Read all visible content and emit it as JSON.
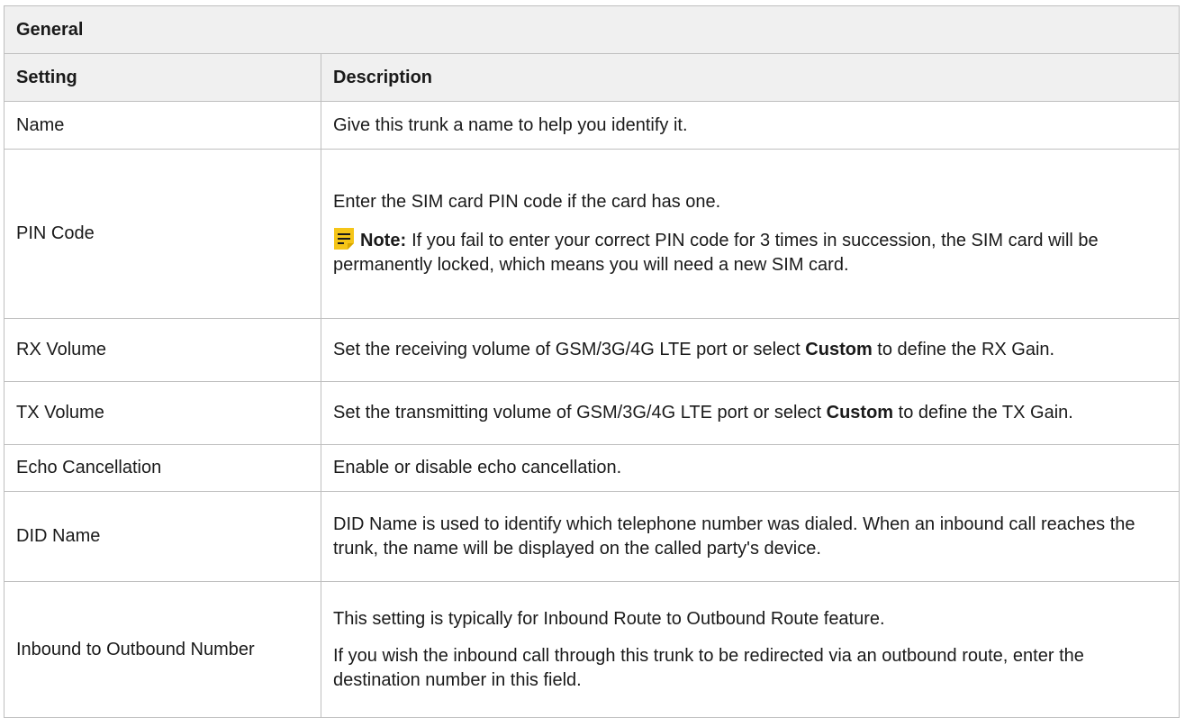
{
  "section_title": "General",
  "columns": {
    "setting": "Setting",
    "description": "Description"
  },
  "rows": {
    "name": {
      "setting": "Name",
      "description": "Give this trunk a name to help you identify it."
    },
    "pin": {
      "setting": "PIN Code",
      "description": "Enter the SIM card PIN code if the card has one.",
      "note_label": "Note:",
      "note_icon": "note-icon",
      "note_text": "If you fail to enter your correct PIN code for 3 times in succession, the SIM card will be permanently locked, which means you will need a new SIM card."
    },
    "rx": {
      "setting": "RX Volume",
      "description_before": "Set the receiving volume of GSM/3G/4G LTE port or select ",
      "keyword": "Custom",
      "description_after": " to define the RX Gain."
    },
    "tx": {
      "setting": "TX Volume",
      "description_before": "Set the transmitting volume of GSM/3G/4G LTE port or select ",
      "keyword": "Custom",
      "description_after": " to define the TX Gain."
    },
    "echo": {
      "setting": "Echo Cancellation",
      "description": "Enable or disable echo cancellation."
    },
    "did": {
      "setting": "DID Name",
      "description": "DID Name is used to identify which telephone number was dialed. When an inbound call reaches the trunk, the name will be displayed on the called party's device."
    },
    "inbound": {
      "setting": "Inbound to Outbound Number",
      "description_1": "This setting is typically for Inbound Route to Outbound Route feature.",
      "description_2": "If you wish the inbound call through this trunk to be redirected via an outbound route, enter the destination number in this field."
    }
  },
  "colors": {
    "header_bg": "#f0f0f0",
    "border": "#bfbfbf",
    "note_icon_bg": "#f5c518"
  }
}
